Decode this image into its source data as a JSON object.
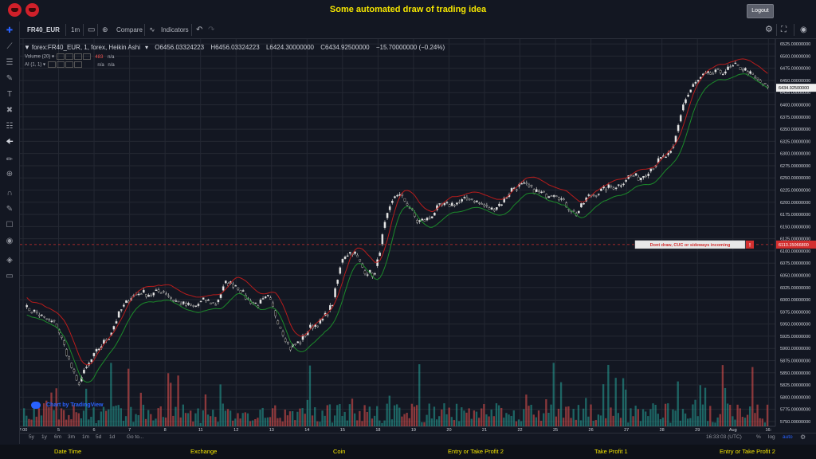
{
  "app": {
    "title": "Some automated draw of trading idea",
    "logout_label": "Logout"
  },
  "toolbar": {
    "symbol": "FR40_EUR",
    "interval": "1m",
    "compare_label": "Compare",
    "indicators_label": "Indicators"
  },
  "legend": {
    "series": "forex:FR40_EUR, 1, forex, Heikin Ashi",
    "open": "O6456.03324223",
    "high": "H6456.03324223",
    "low": "L6424.30000000",
    "close": "C6434.92500000",
    "change": "−15.70000000 (−0.24%)",
    "volume_label": "Volume (20)",
    "volume_value": "483",
    "volume_na": "n/a",
    "ai_label": "AI (1, 1)",
    "ai_na1": "n/a",
    "ai_na2": "n/a"
  },
  "annotation": {
    "text": "Dont draw, CUC or sideways incoming",
    "marker": "!",
    "price_label": "6113.15066800"
  },
  "current_price_label": "6434.92500000",
  "watermark": "Chart by TradingView",
  "bottom": {
    "ranges": [
      "5y",
      "1y",
      "6m",
      "3m",
      "1m",
      "5d",
      "1d"
    ],
    "goto": "Go to...",
    "clock": "16:33:03 (UTC)",
    "pct": "%",
    "log": "log",
    "auto": "auto"
  },
  "footer": {
    "date_time": "Date Time",
    "exchange": "Exchange",
    "coin": "Coin",
    "entry_tp2": "Entry or Take Profit 2",
    "tp1": "Take Profit 1",
    "entry_tp2b": "Entry or Take Profit 2"
  },
  "colors": {
    "up": "#e8e8e8",
    "down": "#0b0b0b",
    "upper_band": "#b71c1c",
    "lower_band": "#1b8a2a",
    "vol_up": "#26a69a",
    "vol_down": "#ef5350",
    "accent": "#f5e600",
    "alert": "#d32f2f"
  },
  "chart_data": {
    "type": "line",
    "title": "",
    "xlabel": "",
    "ylabel": "",
    "x_ticks": [
      "7:00",
      "5",
      "6",
      "7",
      "8",
      "11",
      "12",
      "13",
      "14",
      "15",
      "18",
      "19",
      "20",
      "21",
      "22",
      "25",
      "26",
      "27",
      "28",
      "29",
      "Aug",
      "16:"
    ],
    "y_ticks": [
      6525,
      6500,
      6475,
      6450,
      6425,
      6400,
      6375,
      6350,
      6325,
      6300,
      6275,
      6250,
      6225,
      6200,
      6175,
      6150,
      6125,
      6100,
      6075,
      6050,
      6025,
      6000,
      5975,
      5950,
      5925,
      5900,
      5875,
      5850,
      5825,
      5800,
      5775,
      5750
    ],
    "ylim": [
      5740,
      6535
    ],
    "series": [
      {
        "values": [
          5985,
          5975,
          5960,
          5950,
          5890,
          5825,
          5865,
          5900,
          5925,
          5975,
          6005,
          6015,
          6010,
          6020,
          6000,
          5990,
          5985,
          6000,
          5990,
          6035,
          6030,
          6000,
          5990,
          6005,
          5950,
          5900,
          5915,
          5945,
          5955,
          5990,
          6090,
          6100,
          6060,
          6050,
          6160,
          6220,
          6200,
          6160,
          6165,
          6190,
          6195,
          6200,
          6210,
          6195,
          6185,
          6200,
          6230,
          6235,
          6225,
          6215,
          6220,
          6195,
          6175,
          6210,
          6220,
          6230,
          6235,
          6255,
          6250,
          6270,
          6290,
          6300,
          6400,
          6440,
          6460,
          6465,
          6470,
          6480,
          6470,
          6450,
          6435
        ]
      }
    ],
    "annotation_level": 6113.150668,
    "current_price": 6434.925
  }
}
